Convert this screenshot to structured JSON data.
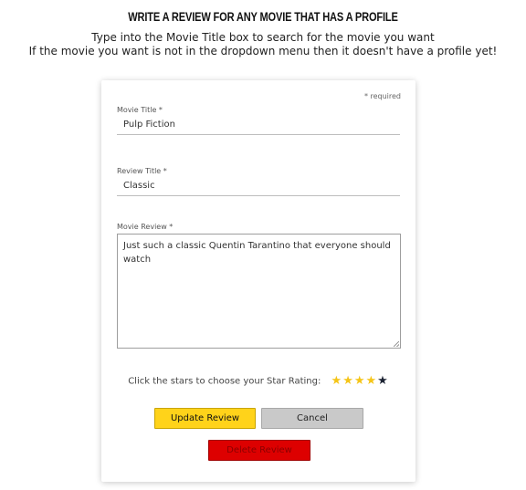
{
  "header": {
    "title": "WRITE A REVIEW FOR ANY MOVIE THAT HAS A PROFILE",
    "instruction_1": "Type into the Movie Title box to search for the movie you want",
    "instruction_2": "If the movie you want is not in the dropdown menu then it doesn't have a profile yet!"
  },
  "form": {
    "required_note": "* required",
    "movie_title": {
      "label": "Movie Title *",
      "value": "Pulp Fiction"
    },
    "review_title": {
      "label": "Review Title *",
      "value": "Classic"
    },
    "movie_review": {
      "label": "Movie Review *",
      "value": "Just such a classic Quentin Tarantino that everyone should watch"
    },
    "rating": {
      "prompt": "Click the stars to choose your Star Rating:",
      "value": 4,
      "max": 5,
      "star_glyph": "★",
      "active_color": "#f5c518",
      "inactive_color": "#1c2333"
    },
    "buttons": {
      "update": "Update Review",
      "cancel": "Cancel",
      "delete": "Delete Review"
    }
  }
}
